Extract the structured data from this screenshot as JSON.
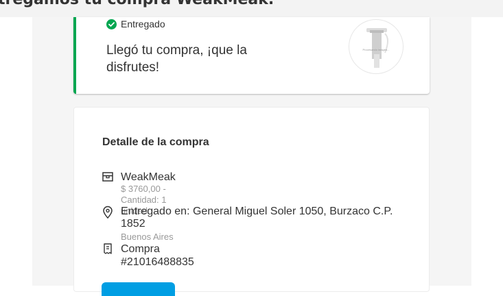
{
  "header": {
    "title": "tregamos tu compra WeakMeak."
  },
  "status": {
    "label": "Entregado",
    "message": "Llegó tu compra, ¡que la disfrutes!",
    "color": "#00a650"
  },
  "product_image": {
    "caption": "Procesando imagen..."
  },
  "detail": {
    "title": "Detalle de la compra",
    "product": {
      "name": "WeakMeak",
      "info": "$ 3760,00 - Cantidad: 1 unidad",
      "icon": "box-icon"
    },
    "delivery": {
      "address": "Entregado en: General Miguel Soler 1050, Burzaco C.P. 1852",
      "region": "Buenos Aires",
      "icon": "location-pin-icon"
    },
    "purchase": {
      "label": "Compra #21016488835",
      "icon": "receipt-icon"
    }
  },
  "colors": {
    "accent": "#009ee3",
    "success": "#00a650"
  }
}
